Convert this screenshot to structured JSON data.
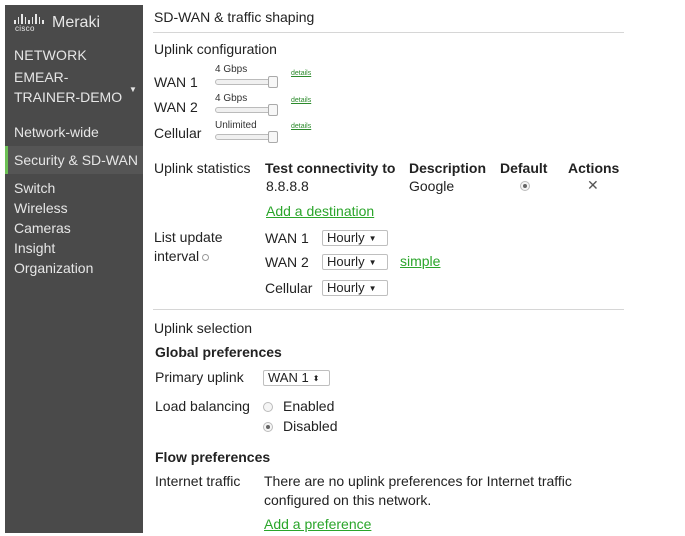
{
  "sidebar": {
    "brand_small": "cisco",
    "brand": "Meraki",
    "network_label": "NETWORK",
    "network_name": "EMEAR-TRAINER-DEMO",
    "items": [
      {
        "label": "Network-wide"
      },
      {
        "label": "Security & SD-WAN"
      },
      {
        "label": "Switch"
      },
      {
        "label": "Wireless"
      },
      {
        "label": "Cameras"
      },
      {
        "label": "Insight"
      },
      {
        "label": "Organization"
      }
    ],
    "active_item": "Security & SD-WAN",
    "accent": "#6cbf55"
  },
  "page": {
    "title": "SD-WAN & traffic shaping"
  },
  "uplink_config": {
    "title": "Uplink configuration",
    "rows": [
      {
        "name": "WAN 1",
        "speed": "4 Gbps",
        "details": "details",
        "level": 1.0
      },
      {
        "name": "WAN 2",
        "speed": "4 Gbps",
        "details": "details",
        "level": 1.0
      },
      {
        "name": "Cellular",
        "speed": "Unlimited",
        "details": "details",
        "level": 1.0
      }
    ]
  },
  "uplink_stats": {
    "title": "Uplink statistics",
    "headers": [
      "Test connectivity to",
      "Description",
      "Default",
      "Actions"
    ],
    "rows": [
      {
        "target": "8.8.8.8",
        "description": "Google",
        "default": true
      }
    ],
    "add_link": "Add a destination",
    "list_update_label_1": "List update",
    "list_update_label_2": "interval",
    "intervals": [
      {
        "uplink": "WAN 1",
        "value": "Hourly"
      },
      {
        "uplink": "WAN 2",
        "value": "Hourly"
      },
      {
        "uplink": "Cellular",
        "value": "Hourly"
      }
    ],
    "simple_link": "simple"
  },
  "uplink_selection": {
    "title": "Uplink selection",
    "global_title": "Global preferences",
    "primary_label": "Primary uplink",
    "primary_value": "WAN 1",
    "load_balancing_label": "Load balancing",
    "lb_options": [
      {
        "label": "Enabled",
        "selected": false
      },
      {
        "label": "Disabled",
        "selected": true
      }
    ],
    "flow_title": "Flow preferences",
    "internet_traffic_label": "Internet traffic",
    "internet_traffic_text_1": "There are no uplink preferences for Internet traffic",
    "internet_traffic_text_2": "configured on this network.",
    "add_preference": "Add a preference"
  },
  "icons": {
    "close": "close-icon",
    "info": "info-icon",
    "caret": "chevron-down-icon"
  }
}
